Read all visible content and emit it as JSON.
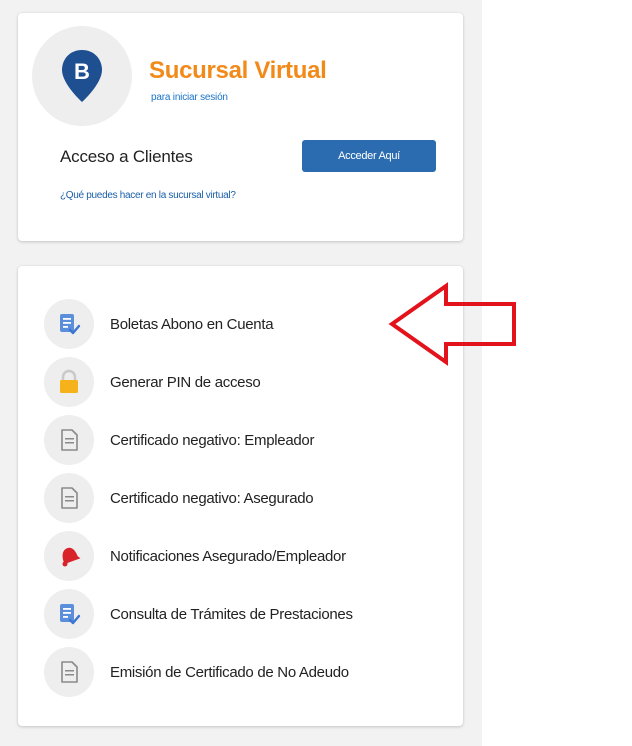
{
  "login_card": {
    "brand_title": "Sucursal Virtual",
    "brand_subtitle": "para iniciar sesión",
    "logo_letter": "B",
    "logo_icon": "map-pin-icon",
    "access_label": "Acceso a Clientes",
    "access_button": "Acceder Aquí",
    "help_link": "¿Qué puedes hacer en la sucursal virtual?"
  },
  "services": [
    {
      "label": "Boletas Abono en Cuenta",
      "icon": "document-check-icon"
    },
    {
      "label": "Generar PIN de acceso",
      "icon": "lock-icon"
    },
    {
      "label": "Certificado negativo: Empleador",
      "icon": "document-icon"
    },
    {
      "label": "Certificado negativo: Asegurado",
      "icon": "document-icon"
    },
    {
      "label": "Notificaciones Asegurado/Empleador",
      "icon": "bell-icon"
    },
    {
      "label": "Consulta de Trámites de Prestaciones",
      "icon": "document-check-icon"
    },
    {
      "label": "Emisión de Certificado de No Adeudo",
      "icon": "document-icon"
    }
  ],
  "annotation": {
    "icon": "arrow-left-icon",
    "color": "#e3131b"
  },
  "colors": {
    "brand_orange": "#f28a1a",
    "link_blue": "#1a73c9",
    "button_blue": "#2b6cb0",
    "logo_navy": "#1d4f91"
  }
}
